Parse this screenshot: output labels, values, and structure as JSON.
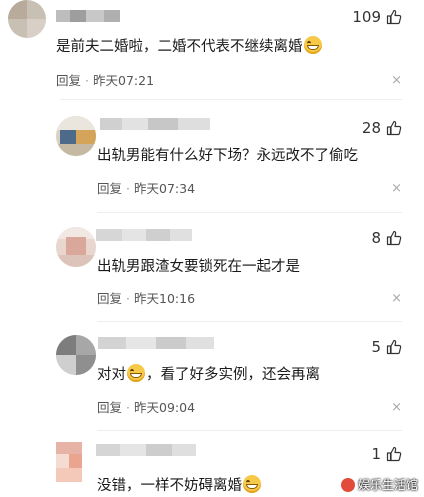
{
  "comments": [
    {
      "likes": "109",
      "text": "是前夫二婚啦，二婚不代表不继续离婚",
      "emoji_after": true,
      "reply": "回复",
      "time": "昨天07:21",
      "close": "×"
    },
    {
      "likes": "28",
      "text": "出轨男能有什么好下场？永远改不了偷吃",
      "reply": "回复",
      "time": "昨天07:34",
      "close": "×"
    },
    {
      "likes": "8",
      "text": "出轨男跟渣女要锁死在一起才是",
      "reply": "回复",
      "time": "昨天10:16",
      "close": "×"
    },
    {
      "likes": "5",
      "text_before": "对对",
      "text_after": "，看了好多实例，还会再离",
      "reply": "回复",
      "time": "昨天09:04",
      "close": "×"
    },
    {
      "likes": "1",
      "text": "没错，一样不妨碍离婚",
      "emoji_after": true
    }
  ],
  "watermark": "娱乐生活馆",
  "icons": {
    "like": "thumbs-up-icon",
    "close": "close-icon",
    "emoji": "grin-emoji-icon"
  }
}
